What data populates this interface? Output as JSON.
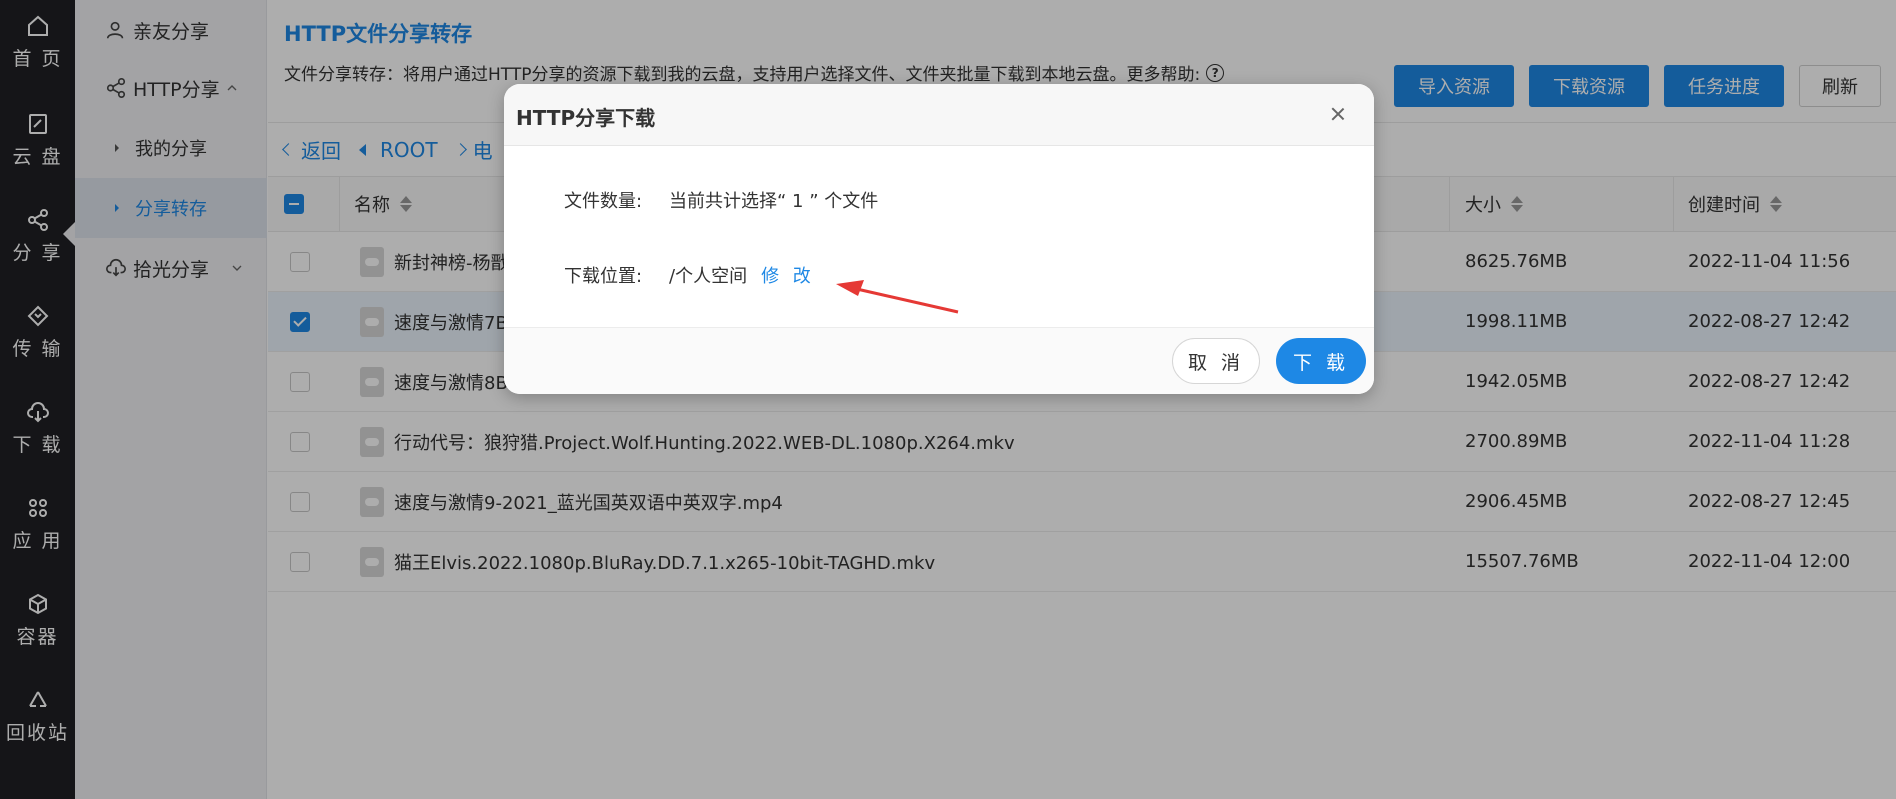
{
  "rail": {
    "items": [
      {
        "label": "首 页",
        "icon": "home-icon"
      },
      {
        "label": "云 盘",
        "icon": "cloud-disk-icon"
      },
      {
        "label": "分 享",
        "icon": "share-icon"
      },
      {
        "label": "传 输",
        "icon": "transfer-icon"
      },
      {
        "label": "下 载",
        "icon": "download-icon"
      },
      {
        "label": "应 用",
        "icon": "apps-icon"
      },
      {
        "label": "容器",
        "icon": "container-icon"
      },
      {
        "label": "回收站",
        "icon": "recycle-icon"
      }
    ]
  },
  "sidebar": {
    "friends_share": "亲友分享",
    "http_share": "HTTP分享",
    "my_share": "我的分享",
    "share_transfer": "分享转存",
    "shiguang_share": "拾光分享"
  },
  "header": {
    "title": "HTTP文件分享转存",
    "description": "文件分享转存：将用户通过HTTP分享的资源下载到我的云盘，支持用户选择文件、文件夹批量下载到本地云盘。更多帮助:",
    "buttons": {
      "import": "导入资源",
      "download": "下载资源",
      "progress": "任务进度",
      "refresh": "刷新"
    }
  },
  "breadcrumb": {
    "back": "返回",
    "root": "ROOT",
    "current": "电"
  },
  "table": {
    "headers": {
      "name": "名称",
      "size": "大小",
      "created": "创建时间"
    },
    "rows": [
      {
        "name": "新封神榜-杨戬",
        "size": "8625.76MB",
        "created": "2022-11-04 11:56",
        "checked": false
      },
      {
        "name": "速度与激情7B",
        "size": "1998.11MB",
        "created": "2022-08-27 12:42",
        "checked": true
      },
      {
        "name": "速度与激情8B",
        "size": "1942.05MB",
        "created": "2022-08-27 12:42",
        "checked": false
      },
      {
        "name": "行动代号：狼狩猎.Project.Wolf.Hunting.2022.WEB-DL.1080p.X264.mkv",
        "size": "2700.89MB",
        "created": "2022-11-04 11:28",
        "checked": false
      },
      {
        "name": "速度与激情9-2021_蓝光国英双语中英双字.mp4",
        "size": "2906.45MB",
        "created": "2022-08-27 12:45",
        "checked": false
      },
      {
        "name": "猫王Elvis.2022.1080p.BluRay.DD.7.1.x265-10bit-TAGHD.mkv",
        "size": "15507.76MB",
        "created": "2022-11-04 12:00",
        "checked": false
      }
    ]
  },
  "modal": {
    "title": "HTTP分享下载",
    "count_label": "文件数量:",
    "count_value": "当前共计选择“ 1 ” 个文件",
    "location_label": "下载位置:",
    "location_value": "/个人空间",
    "modify": "修 改",
    "cancel": "取 消",
    "confirm": "下 载"
  },
  "colors": {
    "accent": "#1e88e5",
    "rail_bg": "#1f2024",
    "annotation_arrow": "#e53935"
  }
}
